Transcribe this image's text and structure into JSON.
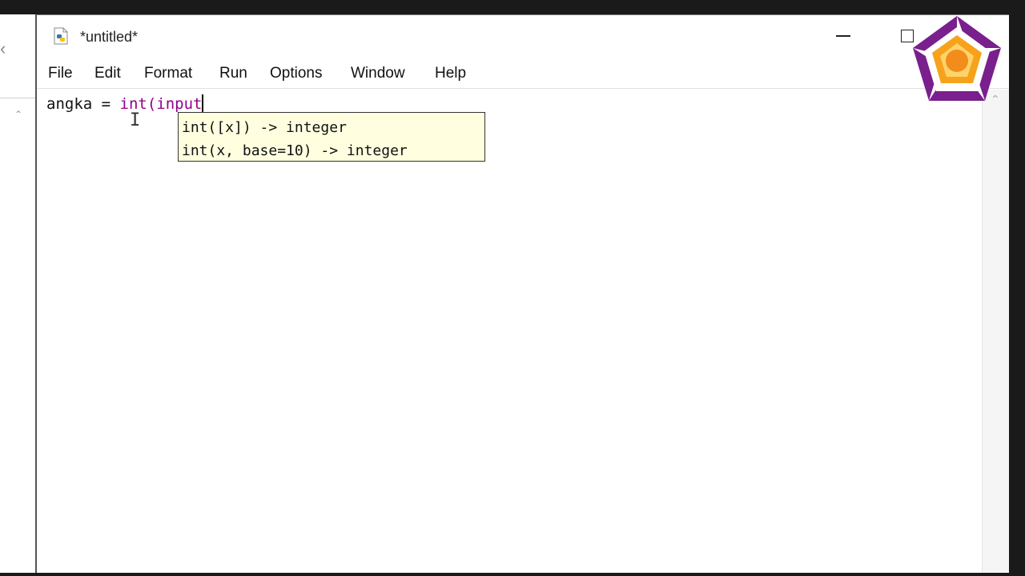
{
  "window": {
    "title": "*untitled*"
  },
  "menu": [
    {
      "label": "File"
    },
    {
      "label": "Edit"
    },
    {
      "label": "Format"
    },
    {
      "label": "Run"
    },
    {
      "label": "Options"
    },
    {
      "label": "Window"
    },
    {
      "label": "Help"
    }
  ],
  "editor": {
    "code_prefix": "angka = ",
    "code_builtin": "int(input"
  },
  "calltip": {
    "lines": [
      "int([x]) -> integer",
      "int(x, base=10) -> integer"
    ]
  },
  "colors": {
    "builtin": "#900090",
    "calltip_bg": "#ffffe0",
    "logo_purple": "#7a1f8e",
    "logo_orange": "#f7a21b"
  },
  "icons": [
    "python-file-icon",
    "minimize-icon",
    "maximize-icon",
    "logo-emblem",
    "text-cursor-icon"
  ]
}
